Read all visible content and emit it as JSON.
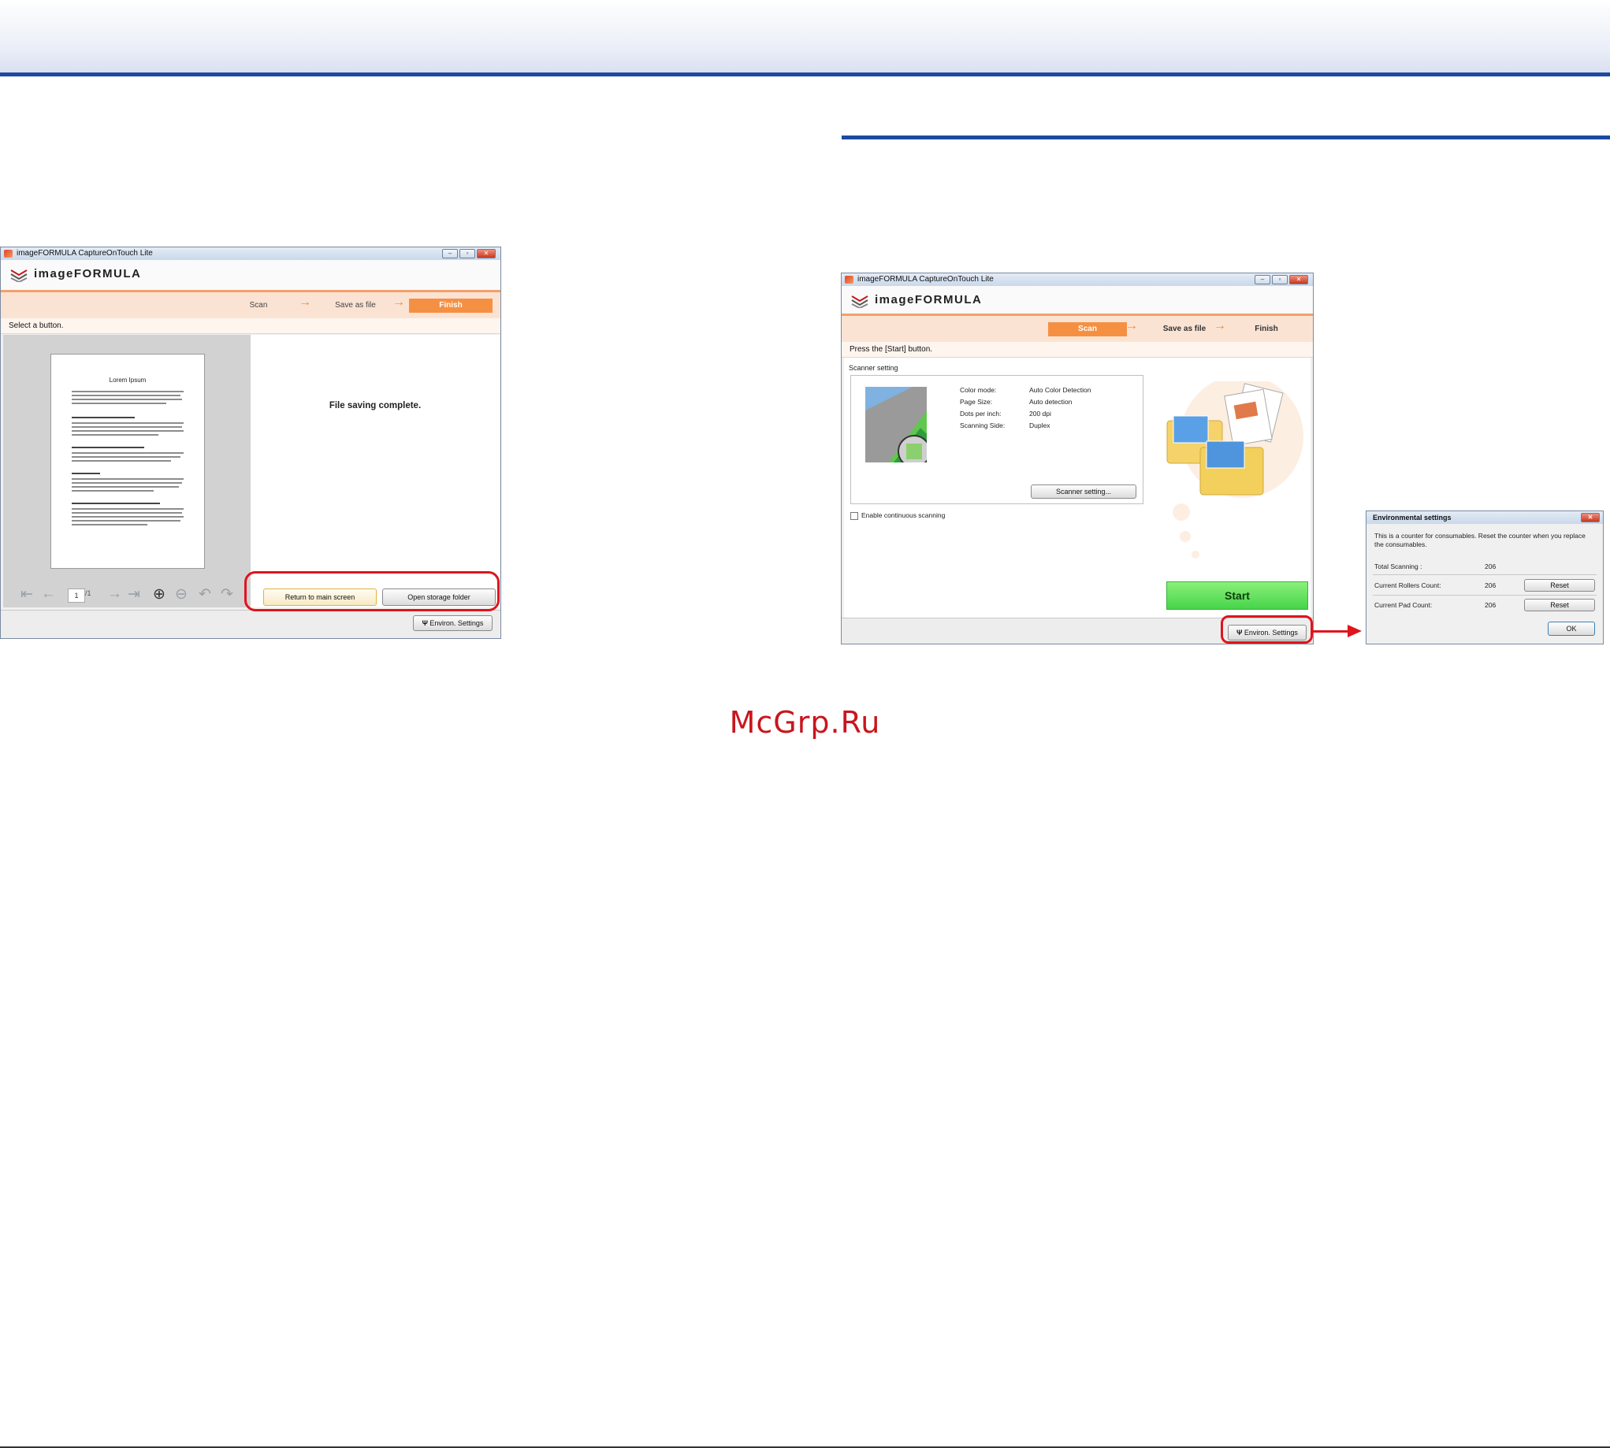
{
  "watermark": "McGrp.Ru",
  "app": {
    "window_title": "imageFORMULA CaptureOnTouch Lite",
    "logo_text": "imageFORMULA",
    "steps": {
      "scan": "Scan",
      "save": "Save as file",
      "finish": "Finish"
    }
  },
  "finish_window": {
    "active_step": "Finish",
    "hint": "Select a button.",
    "document": {
      "title": "Lorem Ipsum",
      "headings": [
        "Mauris vel lorem tincidunt lectus",
        "Donec ullamcorper quam molestie dolor",
        "Mauris tellus",
        "Suspendisse aget felis tincidunt accumsan lobortis"
      ]
    },
    "page_number": "1",
    "page_total": "/1",
    "message": "File saving complete.",
    "buttons": {
      "return": "Return to main screen",
      "open_folder": "Open storage folder"
    },
    "environ_settings": "Environ. Settings"
  },
  "scan_window": {
    "active_step": "Scan",
    "hint": "Press the [Start] button.",
    "scanner_setting_label": "Scanner setting",
    "settings": [
      {
        "label": "Color mode:",
        "value": "Auto Color Detection"
      },
      {
        "label": "Page Size:",
        "value": "Auto detection"
      },
      {
        "label": "Dots per inch:",
        "value": "200 dpi"
      },
      {
        "label": "Scanning Side:",
        "value": "Duplex"
      }
    ],
    "scanner_setting_button": "Scanner setting...",
    "continuous_label": "Enable continuous scanning",
    "continuous_checked": false,
    "start_button": "Start",
    "environ_settings": "Environ. Settings"
  },
  "env_dialog": {
    "title": "Environmental settings",
    "description": "This is a counter for consumables. Reset the counter when you replace the consumables.",
    "rows": [
      {
        "label": "Total Scanning :",
        "value": "206"
      },
      {
        "label": "Current Rollers Count:",
        "value": "206",
        "button": "Reset"
      },
      {
        "label": "Current Pad Count:",
        "value": "206",
        "button": "Reset"
      }
    ],
    "ok": "OK"
  },
  "colors": {
    "accent_orange": "#f59043",
    "highlight_red": "#e0141c",
    "rule_blue": "#1c4aa0",
    "start_green": "#46d44a"
  }
}
